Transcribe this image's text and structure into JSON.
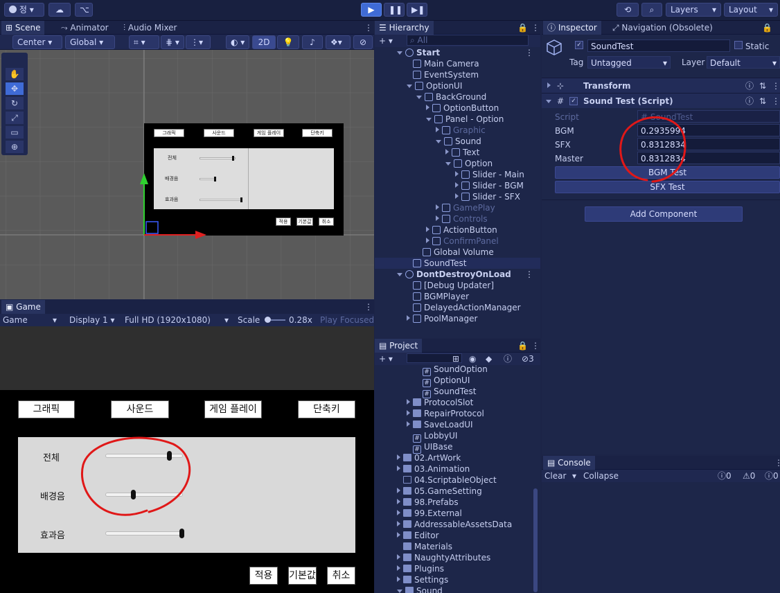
{
  "toolbar": {
    "account_label": "정",
    "layers_label": "Layers",
    "layout_label": "Layout"
  },
  "scene": {
    "tabs": [
      "Scene",
      "Animator",
      "Audio Mixer"
    ],
    "pivot_label": "Center",
    "space_label": "Global",
    "mode_2d": "2D",
    "mini_buttons": [
      "그래픽",
      "사운드",
      "게임 플레이",
      "단축키"
    ],
    "mini_labels": [
      "전체",
      "배경음",
      "효과음"
    ],
    "mini_footer": [
      "적용",
      "기본값",
      "취소"
    ]
  },
  "game": {
    "tab": "Game",
    "view_label": "Game",
    "display_label": "Display 1",
    "resolution_label": "Full HD (1920x1080)",
    "scale_label": "Scale",
    "scale_value": "0.28x",
    "play_focused": "Play Focused",
    "top_buttons": [
      "그래픽",
      "사운드",
      "게임 플레이",
      "단축키"
    ],
    "sliders": [
      {
        "label": "전체",
        "value": 0.83
      },
      {
        "label": "배경음",
        "value": 0.29
      },
      {
        "label": "효과음",
        "value": 0.99
      }
    ],
    "footer_buttons": [
      "적용",
      "기본값",
      "취소"
    ]
  },
  "hierarchy": {
    "tab": "Hierarchy",
    "search_placeholder": "All",
    "items": [
      {
        "label": "Start",
        "depth": 0,
        "kind": "scene",
        "arrow": "down"
      },
      {
        "label": "Main Camera",
        "depth": 1,
        "kind": "obj",
        "arrow": "none"
      },
      {
        "label": "EventSystem",
        "depth": 1,
        "kind": "obj",
        "arrow": "none"
      },
      {
        "label": "OptionUI",
        "depth": 1,
        "kind": "obj",
        "arrow": "down"
      },
      {
        "label": "BackGround",
        "depth": 2,
        "kind": "obj",
        "arrow": "down"
      },
      {
        "label": "OptionButton",
        "depth": 3,
        "kind": "obj",
        "arrow": "right"
      },
      {
        "label": "Panel - Option",
        "depth": 3,
        "kind": "obj",
        "arrow": "down"
      },
      {
        "label": "Graphic",
        "depth": 4,
        "kind": "obj",
        "arrow": "right",
        "dim": true
      },
      {
        "label": "Sound",
        "depth": 4,
        "kind": "obj",
        "arrow": "down"
      },
      {
        "label": "Text",
        "depth": 5,
        "kind": "obj",
        "arrow": "right"
      },
      {
        "label": "Option",
        "depth": 5,
        "kind": "obj",
        "arrow": "down"
      },
      {
        "label": "Slider - Main",
        "depth": 6,
        "kind": "obj",
        "arrow": "right"
      },
      {
        "label": "Slider - BGM",
        "depth": 6,
        "kind": "obj",
        "arrow": "right"
      },
      {
        "label": "Slider - SFX",
        "depth": 6,
        "kind": "obj",
        "arrow": "right"
      },
      {
        "label": "GamePlay",
        "depth": 4,
        "kind": "obj",
        "arrow": "right",
        "dim": true
      },
      {
        "label": "Controls",
        "depth": 4,
        "kind": "obj",
        "arrow": "right",
        "dim": true
      },
      {
        "label": "ActionButton",
        "depth": 3,
        "kind": "obj",
        "arrow": "right"
      },
      {
        "label": "ConfirmPanel",
        "depth": 3,
        "kind": "obj",
        "arrow": "right",
        "dim": true
      },
      {
        "label": "Global Volume",
        "depth": 2,
        "kind": "obj",
        "arrow": "none"
      },
      {
        "label": "SoundTest",
        "depth": 1,
        "kind": "obj",
        "arrow": "none",
        "selected": true
      },
      {
        "label": "DontDestroyOnLoad",
        "depth": 0,
        "kind": "scene",
        "arrow": "down"
      },
      {
        "label": "[Debug Updater]",
        "depth": 1,
        "kind": "obj",
        "arrow": "none"
      },
      {
        "label": "BGMPlayer",
        "depth": 1,
        "kind": "obj",
        "arrow": "none"
      },
      {
        "label": "DelayedActionManager",
        "depth": 1,
        "kind": "obj",
        "arrow": "none"
      },
      {
        "label": "PoolManager",
        "depth": 1,
        "kind": "obj",
        "arrow": "right"
      }
    ]
  },
  "project": {
    "tab": "Project",
    "hidden_count": "3",
    "items": [
      {
        "label": "SoundOption",
        "depth": 3,
        "kind": "script",
        "arrow": "none"
      },
      {
        "label": "OptionUI",
        "depth": 3,
        "kind": "script",
        "arrow": "none"
      },
      {
        "label": "SoundTest",
        "depth": 3,
        "kind": "script",
        "arrow": "none"
      },
      {
        "label": "ProtocolSlot",
        "depth": 2,
        "kind": "folder",
        "arrow": "right"
      },
      {
        "label": "RepairProtocol",
        "depth": 2,
        "kind": "folder",
        "arrow": "right"
      },
      {
        "label": "SaveLoadUI",
        "depth": 2,
        "kind": "folder",
        "arrow": "right"
      },
      {
        "label": "LobbyUI",
        "depth": 2,
        "kind": "script",
        "arrow": "none"
      },
      {
        "label": "UIBase",
        "depth": 2,
        "kind": "script",
        "arrow": "none"
      },
      {
        "label": "02.ArtWork",
        "depth": 1,
        "kind": "folder",
        "arrow": "right"
      },
      {
        "label": "03.Animation",
        "depth": 1,
        "kind": "folder",
        "arrow": "right"
      },
      {
        "label": "04.ScriptableObject",
        "depth": 1,
        "kind": "folder-empty",
        "arrow": "none"
      },
      {
        "label": "05.GameSetting",
        "depth": 1,
        "kind": "folder",
        "arrow": "right"
      },
      {
        "label": "98.Prefabs",
        "depth": 1,
        "kind": "folder",
        "arrow": "right"
      },
      {
        "label": "99.External",
        "depth": 1,
        "kind": "folder",
        "arrow": "right"
      },
      {
        "label": "AddressableAssetsData",
        "depth": 1,
        "kind": "folder",
        "arrow": "right"
      },
      {
        "label": "Editor",
        "depth": 1,
        "kind": "folder",
        "arrow": "right"
      },
      {
        "label": "Materials",
        "depth": 1,
        "kind": "folder",
        "arrow": "none"
      },
      {
        "label": "NaughtyAttributes",
        "depth": 1,
        "kind": "folder",
        "arrow": "right"
      },
      {
        "label": "Plugins",
        "depth": 1,
        "kind": "folder",
        "arrow": "right"
      },
      {
        "label": "Settings",
        "depth": 1,
        "kind": "folder",
        "arrow": "right"
      },
      {
        "label": "Sound",
        "depth": 1,
        "kind": "folder",
        "arrow": "down"
      }
    ]
  },
  "inspector": {
    "tabs": [
      "Inspector",
      "Navigation (Obsolete)"
    ],
    "object_name": "SoundTest",
    "static_label": "Static",
    "tag_label": "Tag",
    "tag_value": "Untagged",
    "layer_label": "Layer",
    "layer_value": "Default",
    "transform_label": "Transform",
    "component_label": "Sound Test (Script)",
    "script_label": "Script",
    "script_value": "SoundTest",
    "fields": [
      {
        "label": "BGM",
        "value": "0.2935994"
      },
      {
        "label": "SFX",
        "value": "0.8312834"
      },
      {
        "label": "Master",
        "value": "0.8312834"
      }
    ],
    "buttons": [
      "BGM Test",
      "SFX Test"
    ],
    "add_component": "Add Component"
  },
  "console": {
    "tab": "Console",
    "clear_label": "Clear",
    "collapse_label": "Collapse",
    "counts": [
      "0",
      "0",
      "0"
    ]
  },
  "colors": {
    "accent": "#3f6bd6",
    "annotation": "#e01818"
  }
}
